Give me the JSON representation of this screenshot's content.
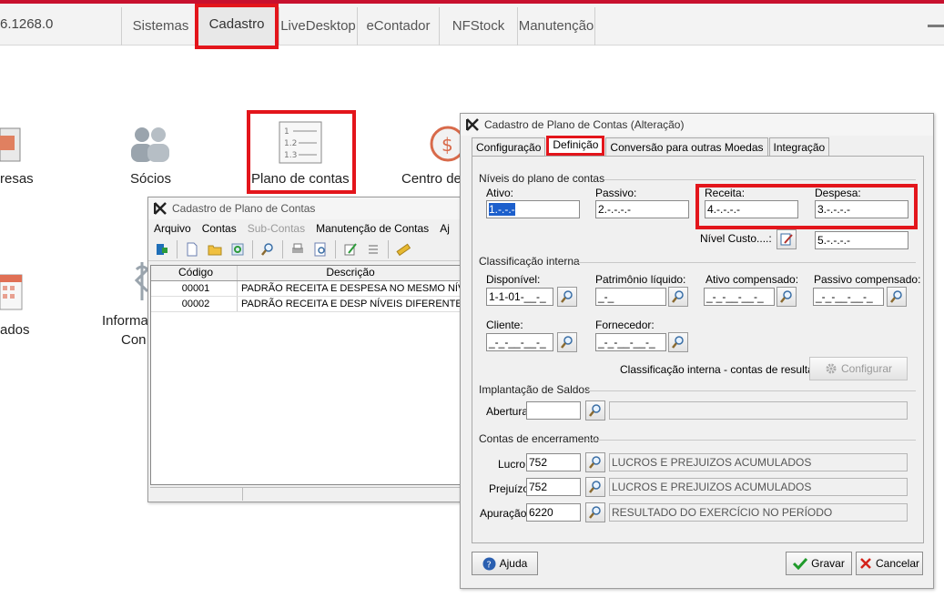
{
  "topbar": {
    "version": "6.1268.0",
    "tabs": [
      "Sistemas",
      "Cadastro",
      "LiveDesktop",
      "eContador",
      "NFStock",
      "Manutenção"
    ]
  },
  "desktop": {
    "icons": {
      "empresas": "resas",
      "socios": "Sócios",
      "plano": "Plano de contas",
      "centro": "Centro de",
      "feriados": "ados",
      "info1": "Informa",
      "info2": "Con"
    }
  },
  "list_window": {
    "title": "Cadastro de Plano de Contas",
    "menu": [
      "Arquivo",
      "Contas",
      "Sub-Contas",
      "Manutenção de Contas",
      "Aj"
    ],
    "columns": [
      "Código",
      "Descrição"
    ],
    "rows": [
      {
        "code": "00001",
        "desc": "PADRÃO RECEITA E DESPESA NO MESMO NÍV"
      },
      {
        "code": "00002",
        "desc": "PADRÃO RECEITA E DESP NÍVEIS DIFERENTES"
      }
    ]
  },
  "dialog": {
    "title": "Cadastro de Plano de Contas (Alteração)",
    "tabs": [
      "Configuração",
      "Definição",
      "Conversão para outras Moedas",
      "Integração"
    ],
    "niveis": {
      "group": "Níveis do plano de contas",
      "ativo_label": "Ativo:",
      "ativo_value": "1.-.-.-",
      "passivo_label": "Passivo:",
      "passivo_value": "2.-.-.-.-",
      "receita_label": "Receita:",
      "receita_value": "4.-.-.-.-",
      "despesa_label": "Despesa:",
      "despesa_value": "3.-.-.-.-",
      "nivel_custo_label": "Nível Custo....:",
      "nivel_custo_value": "5.-.-.-.-"
    },
    "classificacao": {
      "group": "Classificação interna",
      "disponivel_label": "Disponível:",
      "disponivel_value": "1-1-01-__-_",
      "patrimonio_label": "Patrimônio líquido:",
      "patrimonio_value": "_-_",
      "ativo_comp_label": "Ativo compensado:",
      "ativo_comp_value": "_-_-__-__-_",
      "passivo_comp_label": "Passivo compensado:",
      "passivo_comp_value": "_-_-__-__-_",
      "cliente_label": "Cliente:",
      "cliente_value": "_-_-__-__-_",
      "fornecedor_label": "Fornecedor:",
      "fornecedor_value": "_-_-__-__-_",
      "resultado_label": "Classificação interna - contas de resultado:",
      "configurar": "Configurar"
    },
    "implantacao": {
      "group": "Implantação de Saldos",
      "abertura_label": "Abertura",
      "abertura_value": "",
      "abertura_desc": ""
    },
    "encerramento": {
      "group": "Contas de encerramento",
      "lucro_label": "Lucro",
      "lucro_value": "752",
      "lucro_desc": "LUCROS E PREJUIZOS ACUMULADOS",
      "prejuizo_label": "Prejuízo",
      "prejuizo_value": "752",
      "prejuizo_desc": "LUCROS E PREJUIZOS ACUMULADOS",
      "apuracao_label": "Apuração",
      "apuracao_value": "6220",
      "apuracao_desc": "RESULTADO DO EXERCÍCIO NO PERÍODO"
    },
    "buttons": {
      "ajuda": "Ajuda",
      "gravar": "Gravar",
      "cancelar": "Cancelar"
    }
  },
  "colors": {
    "highlight": "#e3151b",
    "accent_top": "#c8102e",
    "selection": "#1c5fcc"
  }
}
